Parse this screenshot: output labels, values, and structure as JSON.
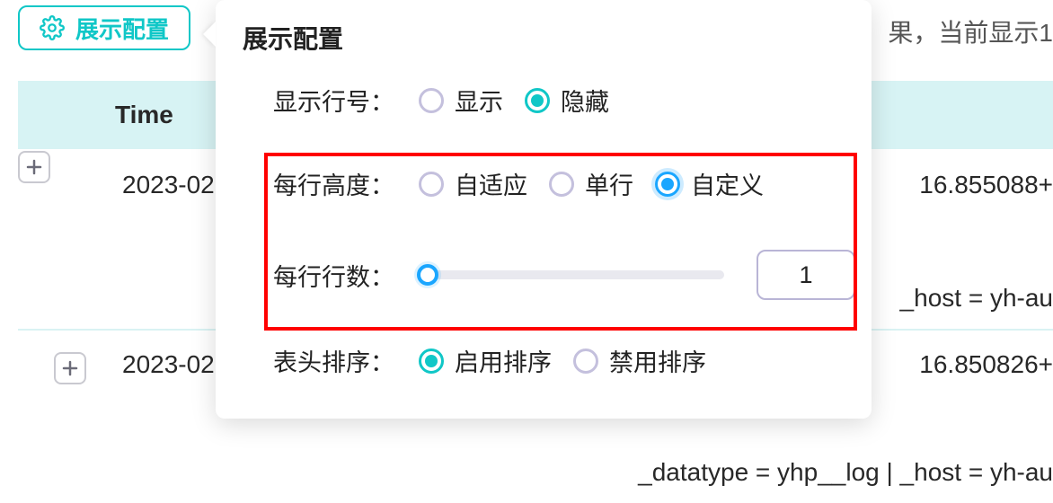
{
  "topbar": {
    "config_button_label": "展示配置",
    "top_right_text": "果，当前显示1"
  },
  "table": {
    "header_time": "Time",
    "row1": {
      "date": "2023-02",
      "right": "16.855088+"
    },
    "row1_extra_right": "_host = yh-au",
    "row2": {
      "date": "2023-02",
      "right": "16.850826+"
    },
    "bottom_right": "_datatype = yhp__log | _host = yh-au"
  },
  "popover": {
    "title": "展示配置",
    "line_number": {
      "label": "显示行号：",
      "options": {
        "show": "显示",
        "hide": "隐藏"
      },
      "selected": "hide"
    },
    "row_height": {
      "label": "每行高度：",
      "options": {
        "auto": "自适应",
        "single": "单行",
        "custom": "自定义"
      },
      "selected": "custom"
    },
    "row_lines": {
      "label": "每行行数：",
      "value": "1"
    },
    "header_sort": {
      "label": "表头排序：",
      "options": {
        "enable": "启用排序",
        "disable": "禁用排序"
      },
      "selected": "enable"
    }
  }
}
